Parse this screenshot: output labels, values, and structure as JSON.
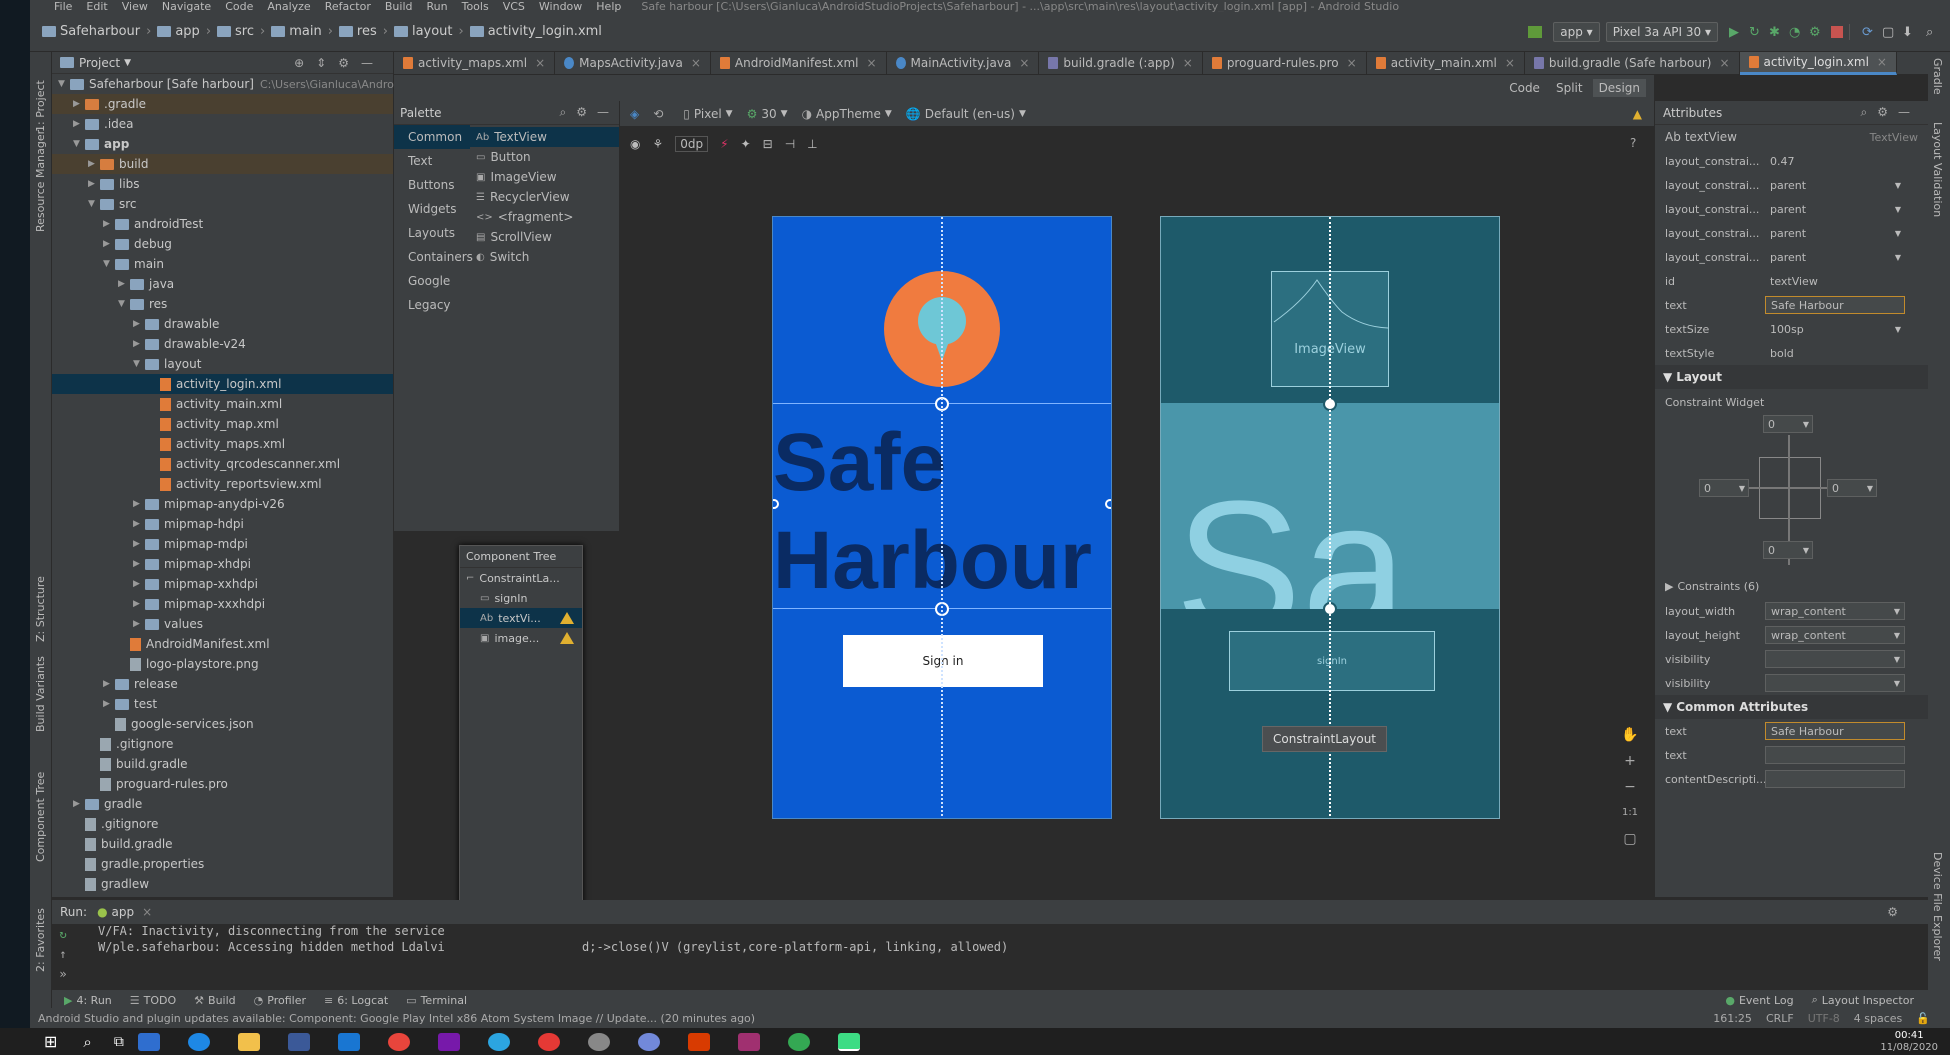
{
  "menu": [
    "File",
    "Edit",
    "View",
    "Navigate",
    "Code",
    "Analyze",
    "Refactor",
    "Build",
    "Run",
    "Tools",
    "VCS",
    "Window",
    "Help"
  ],
  "window_title": "Safe harbour [C:\\Users\\Gianluca\\AndroidStudioProjects\\Safeharbour] - ...\\app\\src\\main\\res\\layout\\activity_login.xml [app] - Android Studio",
  "breadcrumbs": [
    "Safeharbour",
    "app",
    "src",
    "main",
    "res",
    "layout",
    "activity_login.xml"
  ],
  "run_config": "app",
  "device": "Pixel 3a API 30",
  "project_panel": {
    "title": "Project",
    "tree": [
      {
        "label": "Safeharbour [Safe harbour]",
        "suffix": "C:\\Users\\Gianluca\\Android",
        "depth": 0,
        "kind": "root"
      },
      {
        "label": ".gradle",
        "depth": 1,
        "kind": "folder-orange"
      },
      {
        "label": ".idea",
        "depth": 1,
        "kind": "folder"
      },
      {
        "label": "app",
        "depth": 1,
        "kind": "folder-blue",
        "bold": true
      },
      {
        "label": "build",
        "depth": 2,
        "kind": "folder-orange"
      },
      {
        "label": "libs",
        "depth": 2,
        "kind": "folder"
      },
      {
        "label": "src",
        "depth": 2,
        "kind": "folder"
      },
      {
        "label": "androidTest",
        "depth": 3,
        "kind": "folder"
      },
      {
        "label": "debug",
        "depth": 3,
        "kind": "folder"
      },
      {
        "label": "main",
        "depth": 3,
        "kind": "folder"
      },
      {
        "label": "java",
        "depth": 4,
        "kind": "folder-blue"
      },
      {
        "label": "res",
        "depth": 4,
        "kind": "folder"
      },
      {
        "label": "drawable",
        "depth": 5,
        "kind": "folder"
      },
      {
        "label": "drawable-v24",
        "depth": 5,
        "kind": "folder"
      },
      {
        "label": "layout",
        "depth": 5,
        "kind": "folder"
      },
      {
        "label": "activity_login.xml",
        "depth": 6,
        "kind": "xml",
        "selected": true
      },
      {
        "label": "activity_main.xml",
        "depth": 6,
        "kind": "xml"
      },
      {
        "label": "activity_map.xml",
        "depth": 6,
        "kind": "xml"
      },
      {
        "label": "activity_maps.xml",
        "depth": 6,
        "kind": "xml"
      },
      {
        "label": "activity_qrcodescanner.xml",
        "depth": 6,
        "kind": "xml"
      },
      {
        "label": "activity_reportsview.xml",
        "depth": 6,
        "kind": "xml"
      },
      {
        "label": "mipmap-anydpi-v26",
        "depth": 5,
        "kind": "folder"
      },
      {
        "label": "mipmap-hdpi",
        "depth": 5,
        "kind": "folder"
      },
      {
        "label": "mipmap-mdpi",
        "depth": 5,
        "kind": "folder"
      },
      {
        "label": "mipmap-xhdpi",
        "depth": 5,
        "kind": "folder"
      },
      {
        "label": "mipmap-xxhdpi",
        "depth": 5,
        "kind": "folder"
      },
      {
        "label": "mipmap-xxxhdpi",
        "depth": 5,
        "kind": "folder"
      },
      {
        "label": "values",
        "depth": 5,
        "kind": "folder"
      },
      {
        "label": "AndroidManifest.xml",
        "depth": 4,
        "kind": "xml"
      },
      {
        "label": "logo-playstore.png",
        "depth": 4,
        "kind": "file"
      },
      {
        "label": "release",
        "depth": 3,
        "kind": "folder"
      },
      {
        "label": "test",
        "depth": 3,
        "kind": "folder"
      },
      {
        "label": "google-services.json",
        "depth": 3,
        "kind": "file"
      },
      {
        "label": ".gitignore",
        "depth": 2,
        "kind": "file"
      },
      {
        "label": "build.gradle",
        "depth": 2,
        "kind": "file"
      },
      {
        "label": "proguard-rules.pro",
        "depth": 2,
        "kind": "file"
      },
      {
        "label": "gradle",
        "depth": 1,
        "kind": "folder"
      },
      {
        "label": ".gitignore",
        "depth": 1,
        "kind": "file"
      },
      {
        "label": "build.gradle",
        "depth": 1,
        "kind": "file"
      },
      {
        "label": "gradle.properties",
        "depth": 1,
        "kind": "file"
      },
      {
        "label": "gradlew",
        "depth": 1,
        "kind": "file"
      }
    ]
  },
  "editor_tabs": [
    "activity_maps.xml",
    "MapsActivity.java",
    "AndroidManifest.xml",
    "MainActivity.java",
    "build.gradle (:app)",
    "proguard-rules.pro",
    "activity_main.xml",
    "build.gradle (Safe harbour)",
    "activity_login.xml"
  ],
  "active_tab": "activity_login.xml",
  "view_modes": [
    "Code",
    "Split",
    "Design"
  ],
  "palette": {
    "title": "Palette",
    "categories": [
      "Common",
      "Text",
      "Buttons",
      "Widgets",
      "Layouts",
      "Containers",
      "Google",
      "Legacy"
    ],
    "items": [
      "TextView",
      "Button",
      "ImageView",
      "RecyclerView",
      "<fragment>",
      "ScrollView",
      "Switch"
    ]
  },
  "design_toolbar": {
    "device": "Pixel",
    "api": "30",
    "theme": "AppTheme",
    "locale": "Default (en-us)",
    "margin": "0dp"
  },
  "preview": {
    "title_line1": "Safe",
    "title_line2": "Harbour",
    "button": "Sign in"
  },
  "blueprint": {
    "image": "ImageView",
    "title": "Sa",
    "button": "signIn",
    "layout_label": "ConstraintLayout"
  },
  "component_tree": {
    "title": "Component Tree",
    "items": [
      "ConstraintLa...",
      "signIn",
      "textVi...",
      "image..."
    ]
  },
  "attributes": {
    "title": "Attributes",
    "widget": "textView",
    "widget_type": "TextView",
    "rows": [
      {
        "k": "layout_constrai...",
        "v": "0.47"
      },
      {
        "k": "layout_constrai...",
        "v": "parent"
      },
      {
        "k": "layout_constrai...",
        "v": "parent"
      },
      {
        "k": "layout_constrai...",
        "v": "parent"
      },
      {
        "k": "layout_constrai...",
        "v": "parent"
      },
      {
        "k": "id",
        "v": "textView"
      },
      {
        "k": "text",
        "v": "Safe Harbour"
      },
      {
        "k": "textSize",
        "v": "100sp"
      },
      {
        "k": "textStyle",
        "v": "bold"
      }
    ],
    "layout_section": "Layout",
    "constraint_widget": "Constraint Widget",
    "margins": [
      "0",
      "0",
      "0",
      "0"
    ],
    "constraints": "Constraints (6)",
    "layout_rows": [
      {
        "k": "layout_width",
        "v": "wrap_content"
      },
      {
        "k": "layout_height",
        "v": "wrap_content"
      },
      {
        "k": "visibility",
        "v": ""
      },
      {
        "k": "visibility",
        "v": ""
      }
    ],
    "common_section": "Common Attributes",
    "common_rows": [
      {
        "k": "text",
        "v": "Safe Harbour"
      },
      {
        "k": "text",
        "v": ""
      },
      {
        "k": "contentDescripti...",
        "v": ""
      }
    ]
  },
  "run": {
    "label": "Run:",
    "config": "app",
    "lines": [
      "V/FA: Inactivity, disconnecting from the service",
      "W/ple.safeharbou: Accessing hidden method Ldalvi",
      "d;->close()V (greylist,core-platform-api, linking, allowed)"
    ]
  },
  "bottom_tabs": [
    "4: Run",
    "TODO",
    "Build",
    "Profiler",
    "6: Logcat",
    "Terminal"
  ],
  "bottom_right": [
    "Event Log",
    "Layout Inspector"
  ],
  "status": {
    "message": "Android Studio and plugin updates available: Component: Google Play Intel x86 Atom System Image // Update... (20 minutes ago)",
    "position": "161:25",
    "eol": "CRLF",
    "enc": "UTF-8",
    "indent": "4 spaces"
  },
  "taskbar": {
    "time": "00:41",
    "date": "11/08/2020"
  },
  "left_strip": [
    "1: Project",
    "Resource Manager",
    "Z: Structure",
    "Build Variants",
    "Component Tree",
    "2: Favorites"
  ],
  "right_strip": [
    "Gradle",
    "Layout Validation",
    "Device File Explorer"
  ],
  "colors": {
    "preview_bg": "#0b5bd2",
    "blueprint_bg": "#1e5a6a",
    "accent": "#4a88c7",
    "logo": "#f07b3f"
  }
}
